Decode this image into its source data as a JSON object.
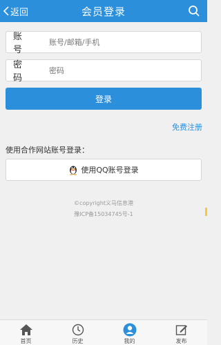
{
  "header": {
    "back_label": "返回",
    "title": "会员登录",
    "search_icon": "search-icon"
  },
  "form": {
    "account": {
      "label": "账 号",
      "placeholder": "账号/邮箱/手机"
    },
    "password": {
      "label": "密 码",
      "placeholder": "密码"
    },
    "login_label": "登录",
    "register_link": "免费注册",
    "partner_text": "使用合作网站账号登录：",
    "qq_login_label": "使用QQ账号登录"
  },
  "footer": {
    "copyright": "©copyright义马信息港",
    "icp": "豫ICP备15034745号-1"
  },
  "tabbar": {
    "items": [
      {
        "label": "首页",
        "icon": "home-icon"
      },
      {
        "label": "历史",
        "icon": "clock-icon"
      },
      {
        "label": "我的",
        "icon": "user-icon"
      },
      {
        "label": "发布",
        "icon": "edit-icon"
      }
    ]
  },
  "colors": {
    "primary": "#2b8fdc",
    "background": "#f0f0f0",
    "accent_tab": "#f5c842"
  }
}
